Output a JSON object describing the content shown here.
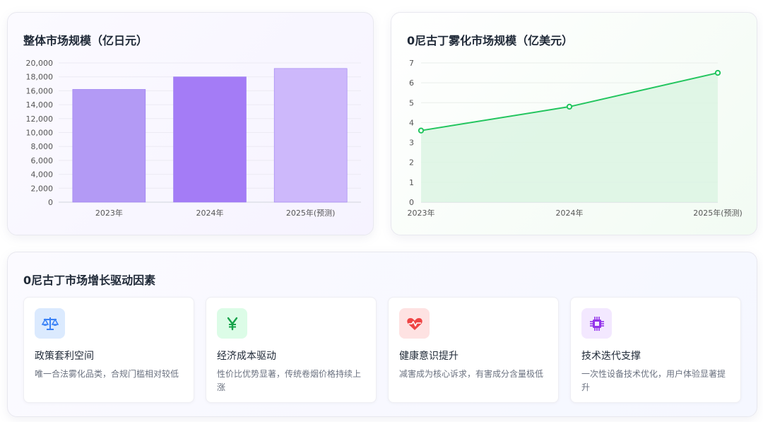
{
  "bar_card": {
    "title": "整体市场规模（亿日元）"
  },
  "line_card": {
    "title": "0尼古丁雾化市场规模（亿美元）"
  },
  "factors_card": {
    "title": "0尼古丁市场增长驱动因素",
    "items": [
      {
        "icon": "balance-scale-icon",
        "title": "政策套利空间",
        "desc": "唯一合法雾化品类，合规门槛相对较低",
        "icon_color": "#3b82f6",
        "icon_bg": "#dbeafe"
      },
      {
        "icon": "yen-icon",
        "title": "经济成本驱动",
        "desc": "性价比优势显著，传统卷烟价格持续上涨",
        "icon_color": "#16a34a",
        "icon_bg": "#dcfce7"
      },
      {
        "icon": "heartbeat-icon",
        "title": "健康意识提升",
        "desc": "减害成为核心诉求，有害成分含量极低",
        "icon_color": "#ef4444",
        "icon_bg": "#fee2e2"
      },
      {
        "icon": "microchip-icon",
        "title": "技术迭代支撑",
        "desc": "一次性设备技术优化，用户体验显著提升",
        "icon_color": "#9333ea",
        "icon_bg": "#f3e8ff"
      }
    ]
  },
  "colors": {
    "bar_2023": "#b39af5",
    "bar_2024": "#a47cf6",
    "bar_2025": "#cdb8fb",
    "line": "#22c55e",
    "line_fill": "#dcf5e3"
  },
  "chart_data": [
    {
      "type": "bar",
      "title": "整体市场规模（亿日元）",
      "categories": [
        "2023年",
        "2024年",
        "2025年(预测)"
      ],
      "values": [
        16200,
        18000,
        19200
      ],
      "ylim": [
        0,
        20000
      ],
      "yticks": [
        "0",
        "2,000",
        "4,000",
        "6,000",
        "8,000",
        "10,000",
        "12,000",
        "14,000",
        "16,000",
        "18,000",
        "20,000"
      ],
      "grid": true
    },
    {
      "type": "area",
      "title": "0尼古丁雾化市场规模（亿美元）",
      "categories": [
        "2023年",
        "2024年",
        "2025年(预测)"
      ],
      "values": [
        3.6,
        4.8,
        6.5
      ],
      "ylim": [
        0,
        7
      ],
      "yticks": [
        "0",
        "1",
        "2",
        "3",
        "4",
        "5",
        "6",
        "7"
      ],
      "grid": true
    }
  ]
}
